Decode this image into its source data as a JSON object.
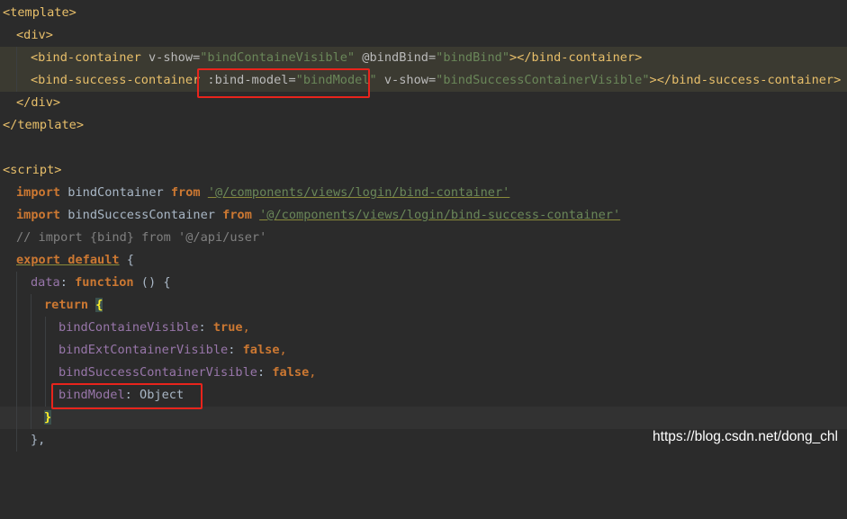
{
  "colors": {
    "background": "#2b2b2b",
    "tag": "#e8bf6a",
    "string": "#6a8759",
    "keyword": "#cc7832",
    "property": "#9876aa",
    "comment": "#808080",
    "text": "#a9b7c6",
    "annotation_box": "#e8241c"
  },
  "code": {
    "l1": {
      "tag": "<template>"
    },
    "l2": {
      "tag": "<div>"
    },
    "l3": {
      "open": "<bind-container",
      "a1": " v-show=",
      "v1": "\"bindContaineVisible\"",
      "a2": " @bindBind=",
      "v2": "\"bindBind\"",
      "close": "></bind-container>"
    },
    "l4": {
      "open": "<bind-success-container",
      "a1": " :bind-model=",
      "v1": "\"bindModel\"",
      "a2": " v-show=",
      "v2": "\"bindSuccessContainerVisible\"",
      "close": "></bind-success-container>"
    },
    "l5": {
      "tag": "</div>"
    },
    "l6": {
      "tag": "</template>"
    },
    "l8": {
      "tag": "<script>"
    },
    "l9": {
      "kw": "import",
      "name": " bindContainer ",
      "from": "from",
      "sp": " ",
      "path": "'@/components/views/login/bind-container'"
    },
    "l10": {
      "kw": "import",
      "name": " bindSuccessContainer ",
      "from": "from",
      "sp": " ",
      "path": "'@/components/views/login/bind-success-container'"
    },
    "l11": {
      "comment": "// import {bind} from '@/api/user'"
    },
    "l12": {
      "kw": "export default",
      "rest": " {"
    },
    "l13": {
      "prop": "data",
      "colon": ": ",
      "kw": "function",
      "rest": " () {"
    },
    "l14": {
      "kw": "return",
      "sp": " ",
      "brace": "{"
    },
    "l15": {
      "prop": "bindContaineVisible",
      "colon": ": ",
      "val": "true",
      "comma": ","
    },
    "l16": {
      "prop": "bindExtContainerVisible",
      "colon": ": ",
      "val": "false",
      "comma": ","
    },
    "l17": {
      "prop": "bindSuccessContainerVisible",
      "colon": ": ",
      "val": "false",
      "comma": ","
    },
    "l18": {
      "prop": "bindModel",
      "colon": ": ",
      "val": "Object"
    },
    "l19": {
      "brace": "}"
    },
    "l20": {
      "text": "},"
    }
  },
  "watermark": "https://blog.csdn.net/dong_chl"
}
